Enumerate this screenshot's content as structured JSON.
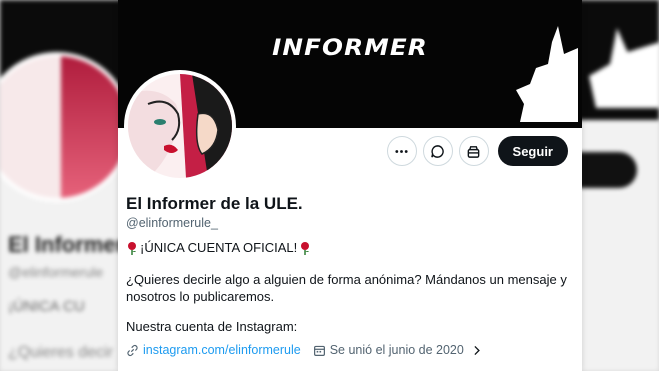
{
  "banner": {
    "logo_text": "INFORMER"
  },
  "profile": {
    "display_name": "El Informer de la ULE.",
    "handle": "@elinformerule_",
    "tagline": "¡ÚNICA CUENTA OFICIAL!",
    "bio": "¿Quieres decirle algo a alguien de forma anónima? Mándanos un mensaje y nosotros lo publicaremos.",
    "bio_instagram": "Nuestra cuenta de Instagram:",
    "link_text": "instagram.com/elinformerule",
    "joined": "Se unió el junio de 2020"
  },
  "actions": {
    "follow_label": "Seguir"
  },
  "background": {
    "name": "El Informer",
    "handle": "@elinformerule",
    "tagline": "¡ÚNICA CU",
    "desc": "¿Quieres decir"
  },
  "colors": {
    "link": "#1d9bf0",
    "follow_bg": "#0f1419",
    "rose": "#c8102e"
  },
  "icons": [
    "more-icon",
    "message-icon",
    "subscribe-icon",
    "link-icon",
    "calendar-icon",
    "chevron-right-icon",
    "rose-emoji-icon"
  ]
}
